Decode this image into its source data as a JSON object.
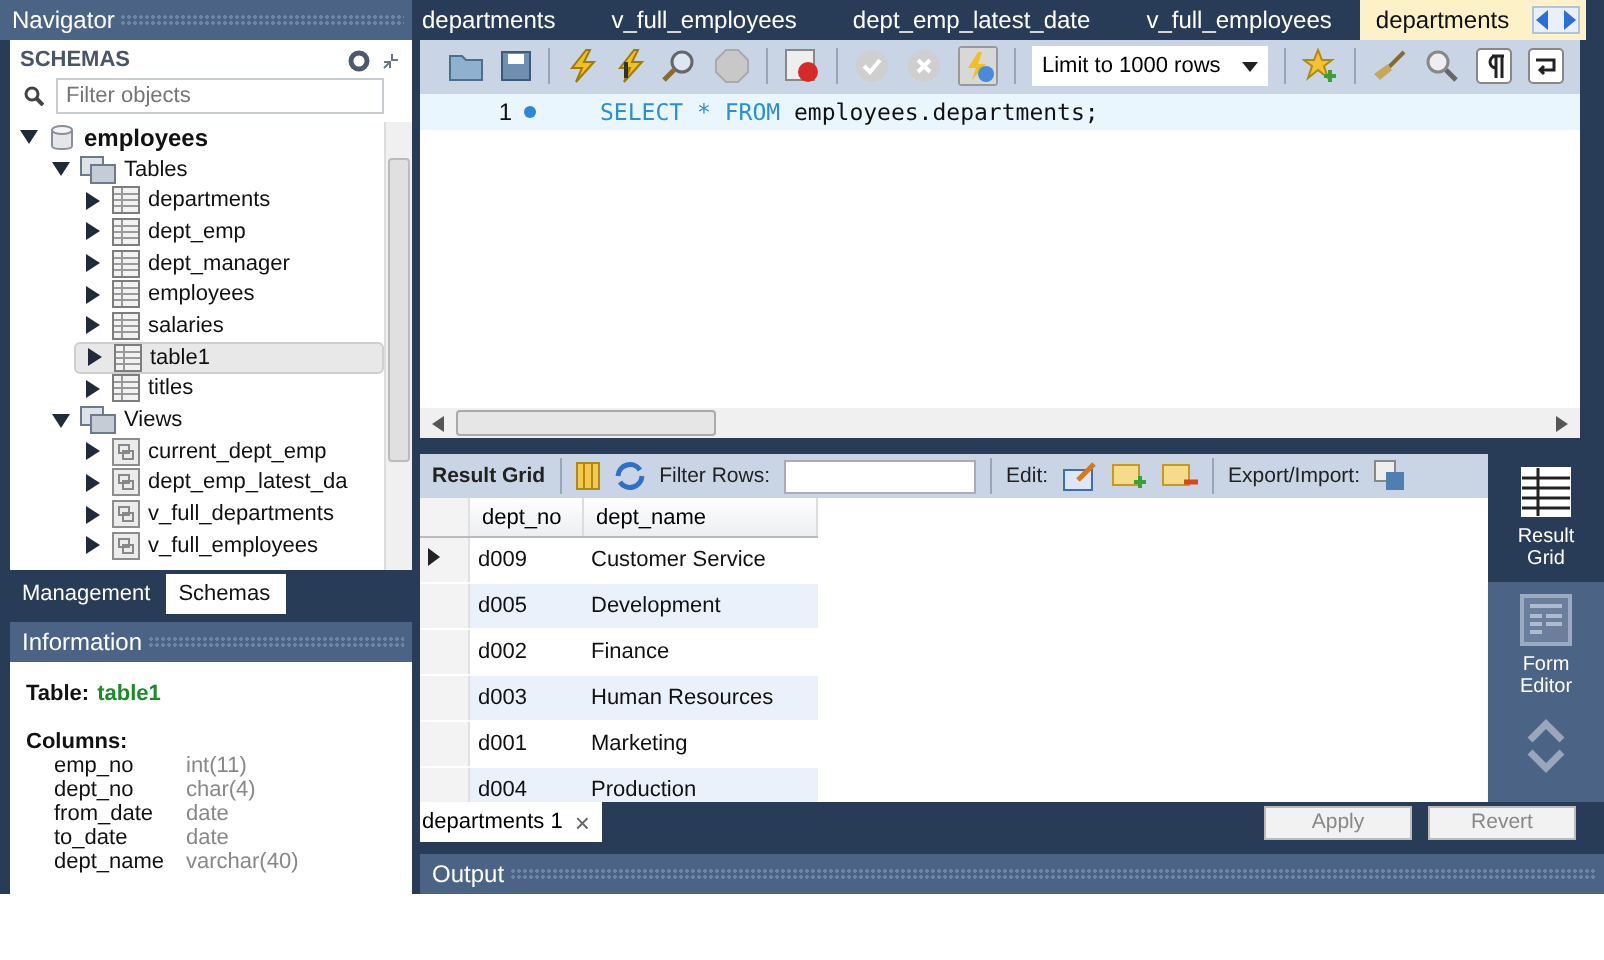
{
  "navigator": {
    "title": "Navigator",
    "schemas_label": "SCHEMAS",
    "filter": {
      "placeholder": "Filter objects"
    },
    "tree": [
      {
        "label": "employees",
        "kind": "schema",
        "expanded": true,
        "selected": false,
        "children": [
          {
            "label": "Tables",
            "kind": "folder",
            "expanded": true,
            "selected": false,
            "children": [
              {
                "label": "departments",
                "kind": "table",
                "expanded": false,
                "selected": false
              },
              {
                "label": "dept_emp",
                "kind": "table",
                "expanded": false,
                "selected": false
              },
              {
                "label": "dept_manager",
                "kind": "table",
                "expanded": false,
                "selected": false
              },
              {
                "label": "employees",
                "kind": "table",
                "expanded": false,
                "selected": false
              },
              {
                "label": "salaries",
                "kind": "table",
                "expanded": false,
                "selected": false
              },
              {
                "label": "table1",
                "kind": "table",
                "expanded": false,
                "selected": true
              },
              {
                "label": "titles",
                "kind": "table",
                "expanded": false,
                "selected": false
              }
            ]
          },
          {
            "label": "Views",
            "kind": "folder",
            "expanded": true,
            "selected": false,
            "children": [
              {
                "label": "current_dept_emp",
                "kind": "view",
                "expanded": false,
                "selected": false
              },
              {
                "label": "dept_emp_latest_da",
                "kind": "view",
                "expanded": false,
                "selected": false
              },
              {
                "label": "v_full_departments",
                "kind": "view",
                "expanded": false,
                "selected": false
              },
              {
                "label": "v_full_employees",
                "kind": "view",
                "expanded": false,
                "selected": false
              }
            ]
          }
        ]
      }
    ],
    "tabs": [
      {
        "label": "Management",
        "selected": false
      },
      {
        "label": "Schemas",
        "selected": true
      }
    ]
  },
  "information": {
    "title": "Information",
    "table_label": "Table:",
    "table_name": "table1",
    "columns_label": "Columns:",
    "columns": [
      {
        "name": "emp_no",
        "type": "int(11)"
      },
      {
        "name": "dept_no",
        "type": "char(4)"
      },
      {
        "name": "from_date",
        "type": "date"
      },
      {
        "name": "to_date",
        "type": "date"
      },
      {
        "name": "dept_name",
        "type": "varchar(40)"
      }
    ]
  },
  "editor_tabs": [
    {
      "label": "departments",
      "selected": false
    },
    {
      "label": "v_full_employees",
      "selected": false
    },
    {
      "label": "dept_emp_latest_date",
      "selected": false
    },
    {
      "label": "v_full_employees",
      "selected": false
    },
    {
      "label": "departments",
      "selected": true
    }
  ],
  "toolbar": {
    "limit": "Limit to 1000 rows"
  },
  "editor": {
    "lines": [
      {
        "number": "1",
        "tokens": [
          {
            "text": "SELECT",
            "kind": "keyword"
          },
          {
            "text": "*",
            "kind": "keyword"
          },
          {
            "text": "FROM",
            "kind": "keyword"
          },
          {
            "text": "employees.departments;",
            "kind": "plain"
          }
        ]
      }
    ]
  },
  "result_toolbar": {
    "result_grid": "Result Grid",
    "filter_label": "Filter Rows:",
    "edit_label": "Edit:",
    "export_label": "Export/Import:"
  },
  "grid": {
    "columns": [
      "dept_no",
      "dept_name"
    ],
    "rows": [
      {
        "cells": [
          "d009",
          "Customer Service"
        ],
        "current": true
      },
      {
        "cells": [
          "d005",
          "Development"
        ],
        "current": false
      },
      {
        "cells": [
          "d002",
          "Finance"
        ],
        "current": false
      },
      {
        "cells": [
          "d003",
          "Human Resources"
        ],
        "current": false
      },
      {
        "cells": [
          "d001",
          "Marketing"
        ],
        "current": false
      },
      {
        "cells": [
          "d004",
          "Production"
        ],
        "current": false
      }
    ]
  },
  "side_panel": [
    {
      "label": "Result Grid",
      "kind": "grid",
      "selected": true
    },
    {
      "label": "Form Editor",
      "kind": "form",
      "selected": false
    }
  ],
  "result_tabs": [
    {
      "label": "departments 1",
      "close": "×"
    }
  ],
  "buttons": [
    {
      "label": "Apply",
      "disabled": true
    },
    {
      "label": "Revert",
      "disabled": true
    }
  ],
  "output": {
    "title": "Output"
  }
}
